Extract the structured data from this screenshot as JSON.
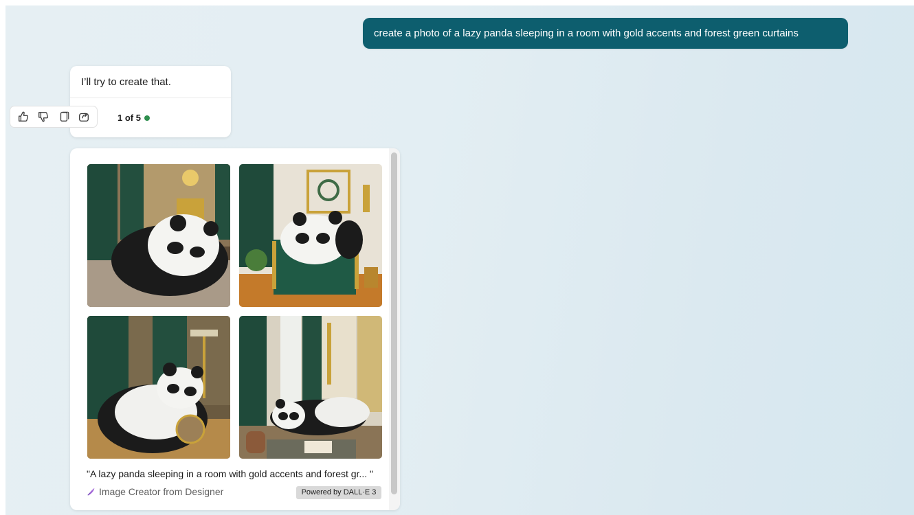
{
  "chat": {
    "user_message": "create a photo of a lazy panda sleeping in a room with gold accents and forest green curtains",
    "bot_message": "I’ll try to create that.",
    "response_counter": "1 of 5",
    "actions": [
      {
        "name": "thumbs-up-icon"
      },
      {
        "name": "thumbs-down-icon"
      },
      {
        "name": "copy-icon"
      },
      {
        "name": "share-icon"
      }
    ],
    "status_color": "#2f8f4e"
  },
  "image_result": {
    "caption": "\"A lazy panda sleeping in a room with gold accents and forest gr... \"",
    "creator_label": "Image Creator from Designer",
    "powered_by": "Powered by DALL·E 3",
    "image_count": 4
  },
  "colors": {
    "user_bubble": "#0d5e6e",
    "curtain_green": "#1f4a3a",
    "gold": "#c9a23a"
  }
}
